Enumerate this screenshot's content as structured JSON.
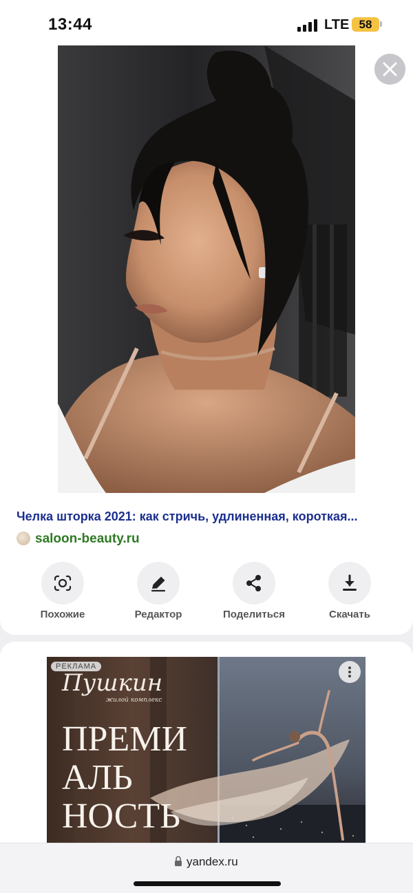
{
  "status_bar": {
    "time": "13:44",
    "network": "LTE",
    "battery": "58",
    "battery_color": "#f5c242"
  },
  "viewer": {
    "close_icon": "close-icon",
    "photo_description_icon": "hairstyle-photo"
  },
  "result": {
    "title": "Челка шторка 2021: как стричь, удлиненная, короткая...",
    "source_domain": "saloon-beauty.ru",
    "title_color": "#1b2f8f",
    "source_color": "#2f7a24"
  },
  "actions": [
    {
      "label": "Похожие",
      "icon": "similar-camera-icon"
    },
    {
      "label": "Редактор",
      "icon": "pencil-icon"
    },
    {
      "label": "Поделиться",
      "icon": "share-icon"
    },
    {
      "label": "Скачать",
      "icon": "download-icon"
    }
  ],
  "ad": {
    "badge": "РЕКЛАМА",
    "brand": "Пушкин",
    "subbrand": "жилой комплекс",
    "headline_lines": [
      "ПРЕМИ",
      "АЛЬ",
      "НОСТЬ"
    ],
    "more_icon": "more-vertical-icon"
  },
  "url_bar": {
    "domain": "yandex.ru",
    "lock_icon": "lock-icon"
  }
}
